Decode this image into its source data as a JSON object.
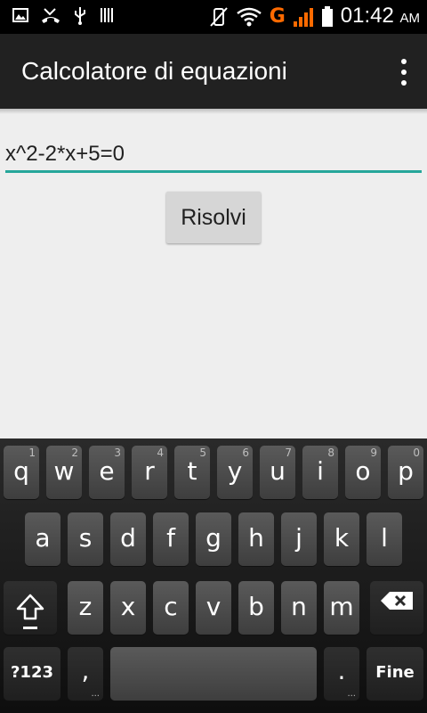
{
  "status_bar": {
    "network": "G",
    "time": "01:42",
    "ampm": "AM"
  },
  "app_bar": {
    "title": "Calcolatore di equazioni"
  },
  "content": {
    "equation_value": "x^2-2*x+5=0",
    "solve_label": "Risolvi"
  },
  "keyboard": {
    "row1": [
      {
        "label": "q",
        "hint": "1"
      },
      {
        "label": "w",
        "hint": "2"
      },
      {
        "label": "e",
        "hint": "3"
      },
      {
        "label": "r",
        "hint": "4"
      },
      {
        "label": "t",
        "hint": "5"
      },
      {
        "label": "y",
        "hint": "6"
      },
      {
        "label": "u",
        "hint": "7"
      },
      {
        "label": "i",
        "hint": "8"
      },
      {
        "label": "o",
        "hint": "9"
      },
      {
        "label": "p",
        "hint": "0"
      }
    ],
    "row2": [
      "a",
      "s",
      "d",
      "f",
      "g",
      "h",
      "j",
      "k",
      "l"
    ],
    "row3": [
      "z",
      "x",
      "c",
      "v",
      "b",
      "n",
      "m"
    ],
    "symbols_label": "?123",
    "comma_label": ",",
    "period_label": ".",
    "action_label": "Fine",
    "more_hint": "..."
  }
}
